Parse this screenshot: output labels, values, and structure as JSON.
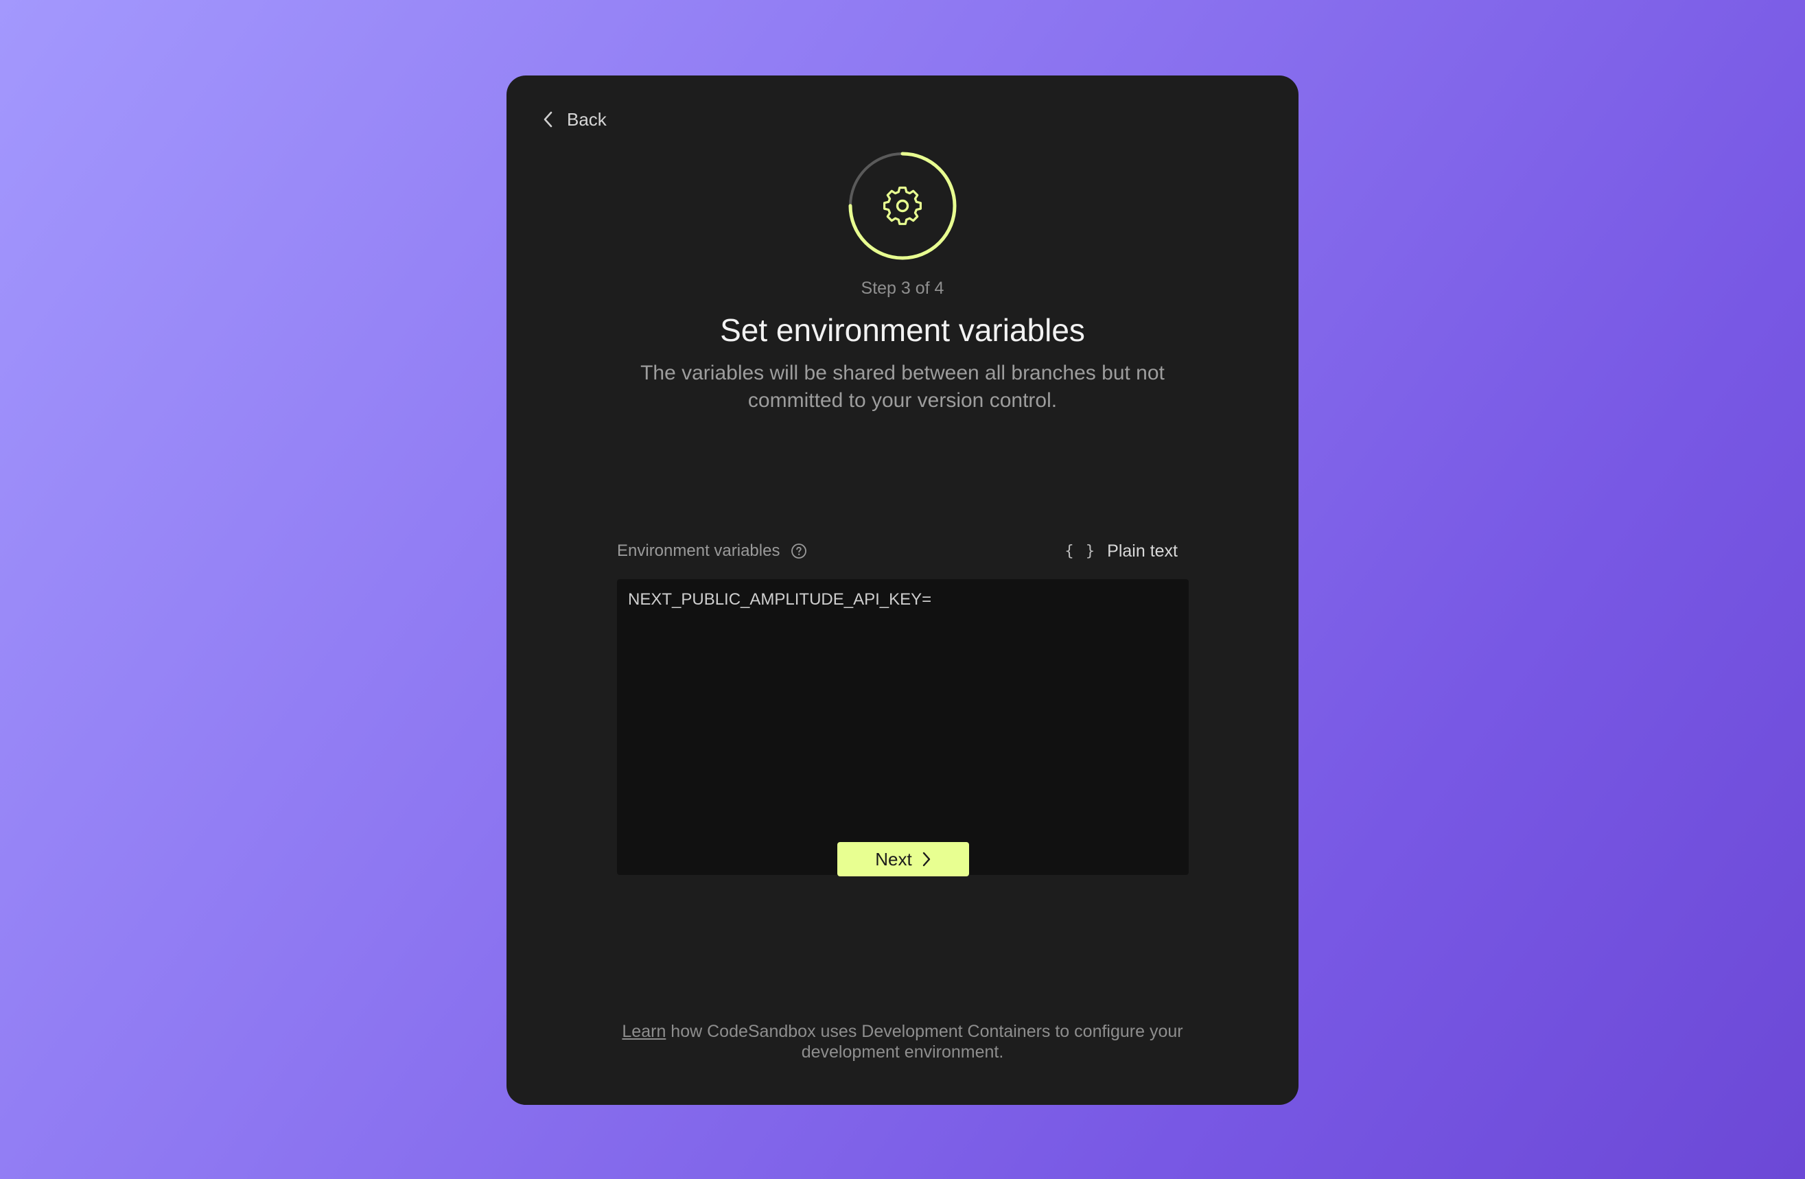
{
  "nav": {
    "back_label": "Back"
  },
  "progress": {
    "step_text": "Step 3 of 4",
    "current_step": 3,
    "total_steps": 4,
    "accent_color": "#e8ff91",
    "track_color": "#5a5a5a",
    "icon": "gear-icon"
  },
  "header": {
    "title": "Set environment variables",
    "description": "The variables will be shared between all branches but not committed to your version control."
  },
  "env_field": {
    "label": "Environment variables",
    "help_icon": "question-circle-icon",
    "mode_icon": "braces-icon",
    "mode_braces": "{ }",
    "mode_label": "Plain text",
    "value": "NEXT_PUBLIC_AMPLITUDE_API_KEY="
  },
  "actions": {
    "next_label": "Next",
    "next_color": "#e8ff91"
  },
  "footer": {
    "link_text": "Learn",
    "text": " how CodeSandbox uses Development Containers to configure your development environment."
  }
}
